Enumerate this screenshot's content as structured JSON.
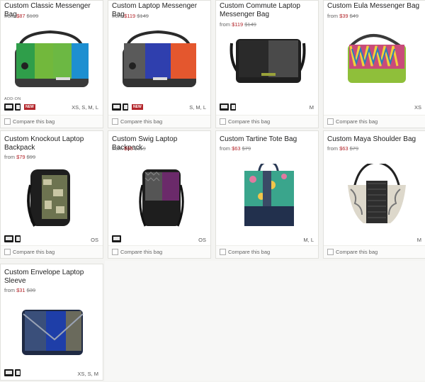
{
  "products": [
    {
      "title": "Custom Classic Messenger Bag",
      "from": "from",
      "sale": "$87",
      "orig": "$109",
      "sizes": "XS, S, M, L",
      "addon": "ADD-ON",
      "badge": "NEW",
      "compare": "Compare this bag",
      "image": "messenger-bag-green-blue"
    },
    {
      "title": "Custom Laptop Messenger Bag",
      "from": "from",
      "sale": "$119",
      "orig": "$149",
      "sizes": "S, M, L",
      "badge": "NEW",
      "compare": "Compare this bag",
      "image": "messenger-bag-tricolor"
    },
    {
      "title": "Custom Commute Laptop Messenger Bag",
      "from": "from",
      "sale": "$119",
      "orig": "$149",
      "sizes": "M",
      "compare": "Compare this bag",
      "image": "commute-bag-black"
    },
    {
      "title": "Custom Eula Messenger Bag",
      "from": "from",
      "sale": "$39",
      "orig": "$49",
      "sizes": "XS",
      "compare": "Compare this bag",
      "image": "eula-bag-pattern"
    },
    {
      "title": "Custom Knockout Laptop Backpack",
      "from": "from",
      "sale": "$79",
      "orig": "$99",
      "sizes": "OS",
      "compare": "Compare this bag",
      "image": "knockout-backpack-camo"
    },
    {
      "title": "Custom Swig Laptop Backpack",
      "from": "from",
      "sale": "$95",
      "orig": "$119",
      "sizes": "OS",
      "compare": "Compare this bag",
      "image": "swig-backpack-purple"
    },
    {
      "title": "Custom Tartine Tote Bag",
      "from": "from",
      "sale": "$63",
      "orig": "$79",
      "sizes": "M, L",
      "compare": "Compare this bag",
      "image": "tartine-tote-floral"
    },
    {
      "title": "Custom Maya Shoulder Bag",
      "from": "from",
      "sale": "$63",
      "orig": "$79",
      "sizes": "M",
      "compare": "Compare this bag",
      "image": "maya-shoulder-bag"
    },
    {
      "title": "Custom Envelope Laptop Sleeve",
      "from": "from",
      "sale": "$31",
      "orig": "$39",
      "sizes": "XS, S, M",
      "image": "envelope-sleeve-blue"
    }
  ],
  "colors": {
    "sale": "#b3262b",
    "badge": "#b3262b"
  }
}
